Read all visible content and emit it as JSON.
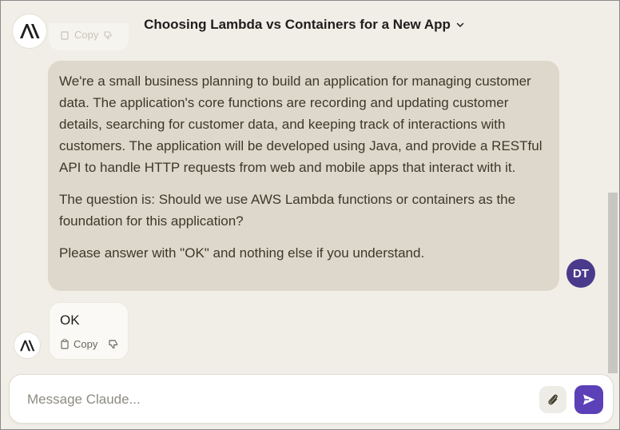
{
  "header": {
    "title": "Choosing Lambda vs Containers for a New App",
    "title_icon": "chevron-down-icon"
  },
  "previous_actions": {
    "copy_label": "Copy"
  },
  "user_message": {
    "paragraphs": [
      "We're a small business planning to build an application for managing customer data. The application's core functions are recording and updating customer details, searching for customer data, and keeping track of interactions with customers. The application will be developed using Java, and provide a RESTful API to handle HTTP requests from web and mobile apps that interact with it.",
      "The question is: Should we use AWS Lambda functions or containers as the foundation for this application?",
      "Please answer with \"OK\" and nothing else if you understand."
    ],
    "avatar_initials": "DT"
  },
  "assistant_message": {
    "text": "OK",
    "copy_label": "Copy",
    "icons": [
      "copy-icon",
      "thumbs-down-icon"
    ]
  },
  "composer": {
    "placeholder": "Message Claude...",
    "value": "",
    "icons": [
      "paperclip-icon",
      "send-icon"
    ]
  },
  "colors": {
    "background": "#f0eee6",
    "user_bubble": "#ddd8cb",
    "avatar": "#4a3a8c",
    "send_button": "#5b40b8"
  }
}
